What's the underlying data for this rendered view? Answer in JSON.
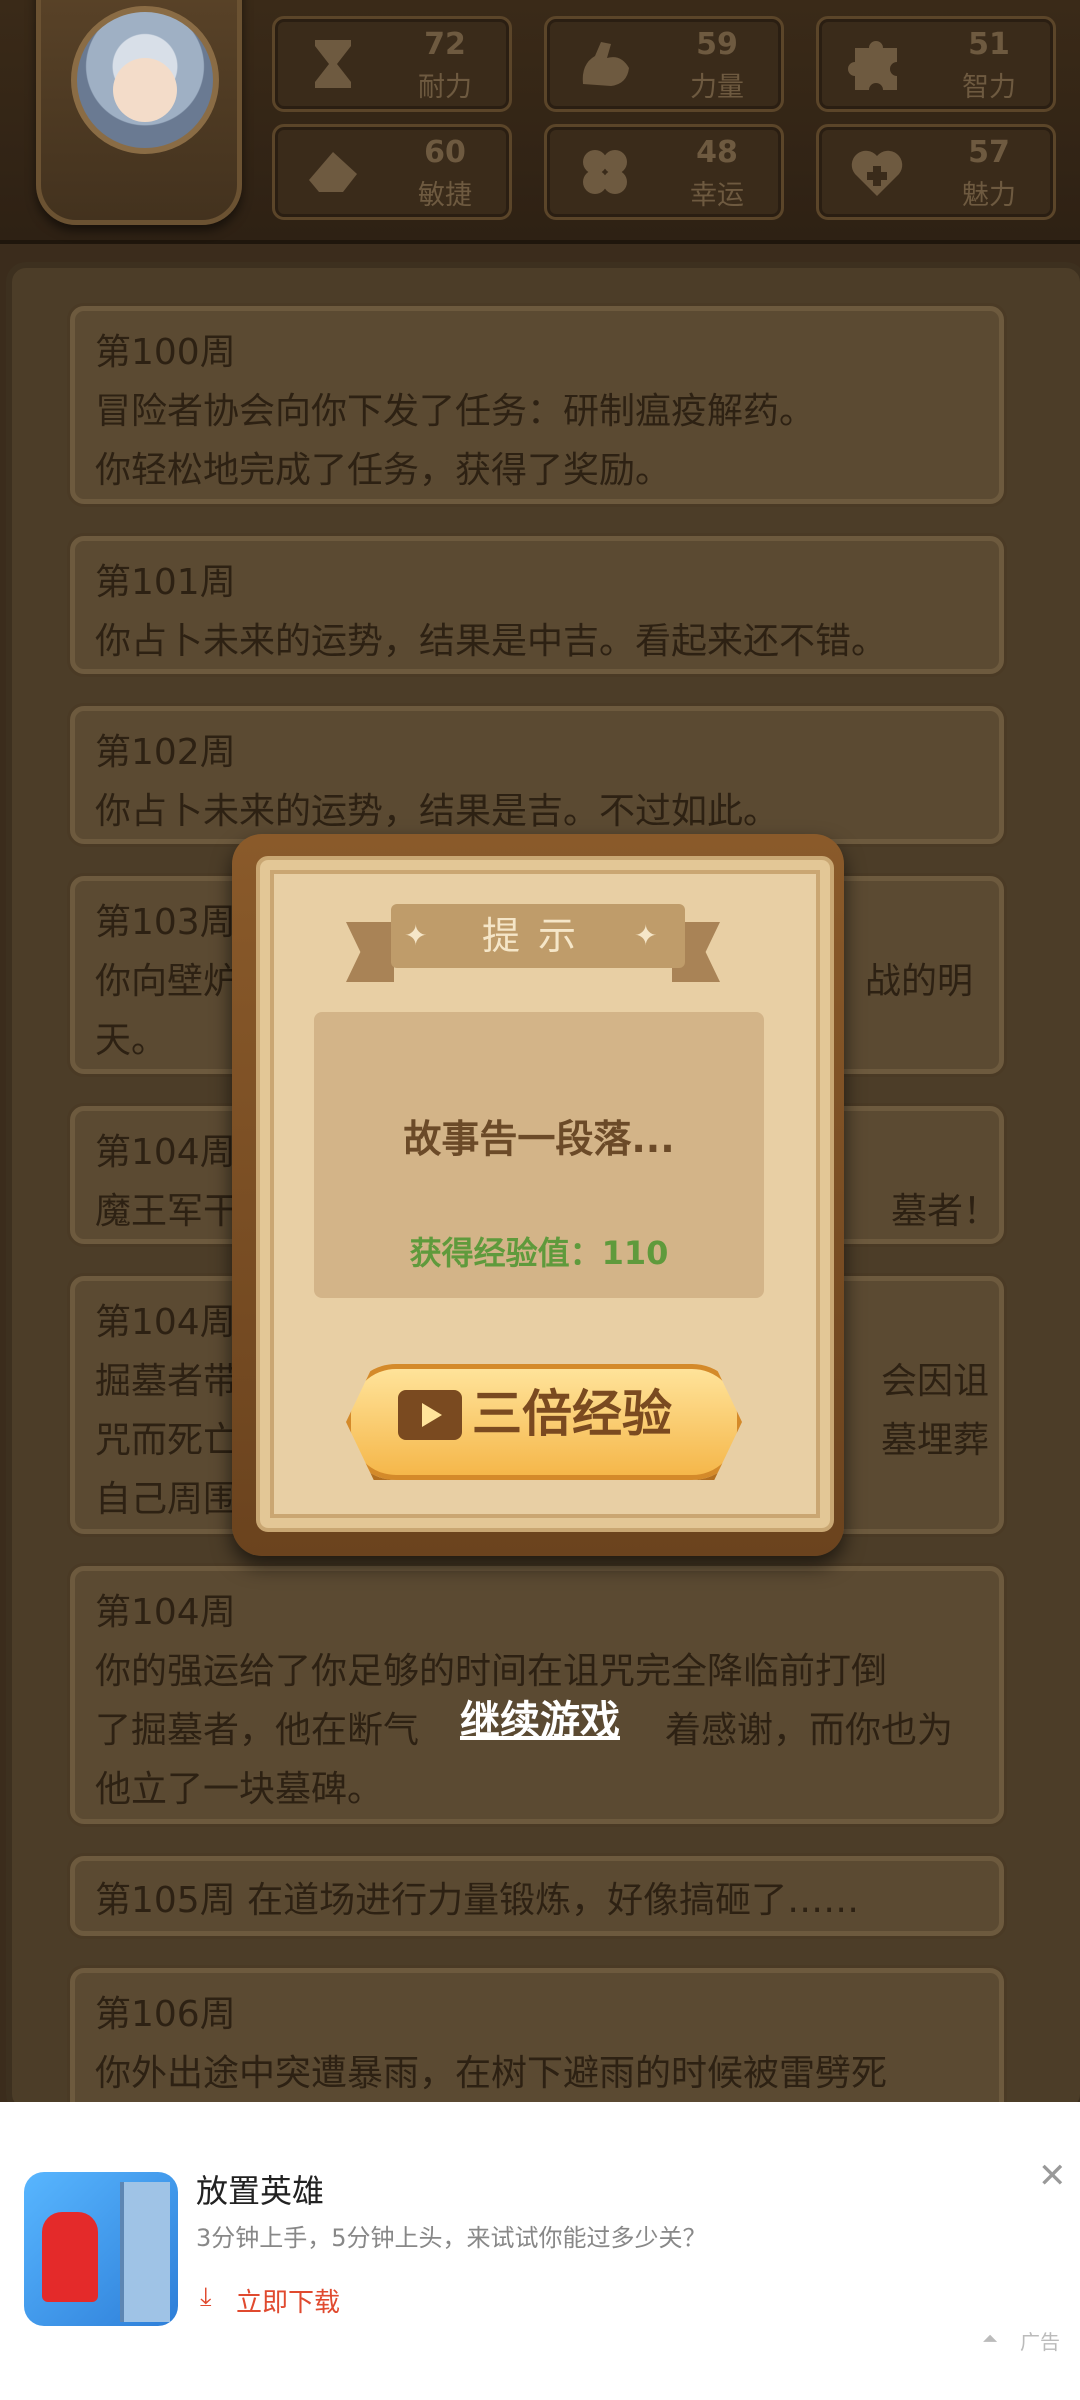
{
  "stats": [
    {
      "value": "72",
      "label": "耐力",
      "icon": "hourglass-icon"
    },
    {
      "value": "59",
      "label": "力量",
      "icon": "muscle-arm-icon"
    },
    {
      "value": "51",
      "label": "智力",
      "icon": "puzzle-piece-icon"
    },
    {
      "value": "60",
      "label": "敏捷",
      "icon": "eraser-icon"
    },
    {
      "value": "48",
      "label": "幸运",
      "icon": "clover-icon"
    },
    {
      "value": "57",
      "label": "魅力",
      "icon": "heart-plus-icon"
    }
  ],
  "events": [
    {
      "lines": [
        "第100周",
        "冒险者协会向你下发了任务：研制瘟疫解药。",
        "你轻松地完成了任务，获得了奖励。"
      ]
    },
    {
      "lines": [
        "第101周",
        "你占卜未来的运势，结果是中吉。看起来还不错。"
      ]
    },
    {
      "lines": [
        "第102周",
        "你占卜未来的运势，结果是吉。不过如此。"
      ]
    },
    {
      "lines": [
        "第103周",
        "你向壁炉",
        "天。"
      ],
      "right": "战的明"
    },
    {
      "lines": [
        "第104周",
        "魔王军干"
      ],
      "right": "墓者！"
    },
    {
      "lines": [
        "第104周",
        "掘墓者带",
        "咒而死亡",
        "自己周围"
      ],
      "right_lines": [
        "会因诅",
        "墓埋葬"
      ]
    },
    {
      "lines": [
        "第104周",
        "你的强运给了你足够的时间在诅咒完全降临前打倒",
        "了掘墓者，他在断气",
        "他立了一块墓碑。"
      ],
      "right": "着感谢，而你也为"
    },
    {
      "lines": [
        "第105周 在道场进行力量锻炼，好像搞砸了……"
      ]
    },
    {
      "lines": [
        "第106周",
        "你外出途中突遭暴雨，在树下避雨的时候被雷劈死"
      ]
    }
  ],
  "modal": {
    "title": "提示",
    "message": "故事告一段落...",
    "exp_text": "获得经验值：110",
    "triple_button": "三倍经验"
  },
  "continue_label": "继续游戏",
  "ad": {
    "title": "放置英雄",
    "description": "3分钟上手，5分钟上头，来试试你能过多少关？",
    "download_label": "立即下载",
    "tag": "广告"
  }
}
